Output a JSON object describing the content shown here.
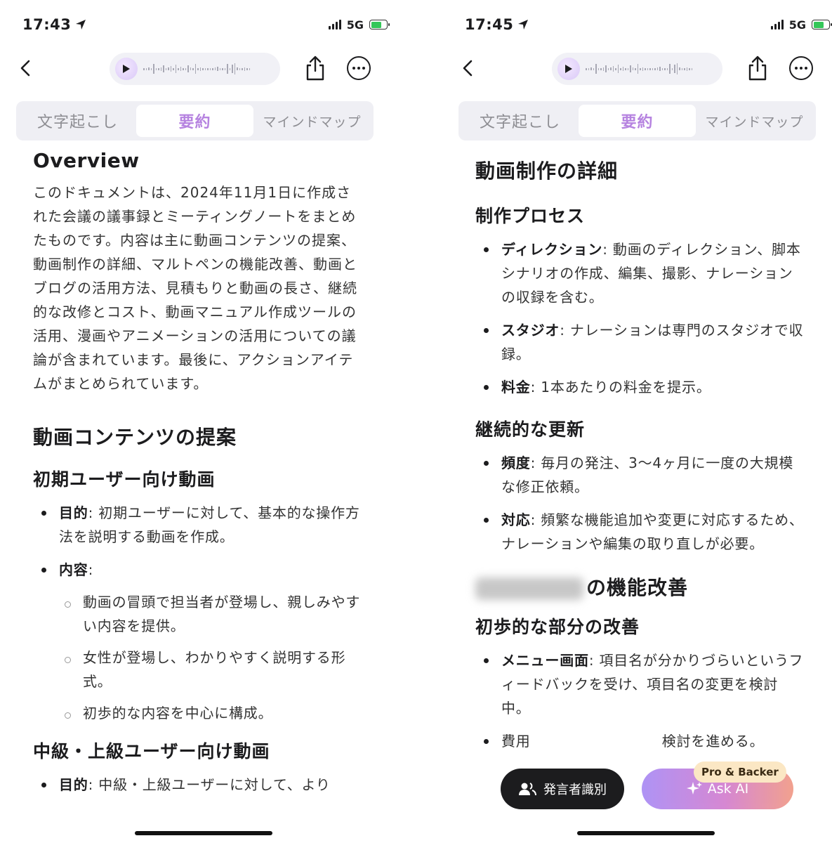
{
  "left": {
    "status": {
      "time": "17:43",
      "network": "5G"
    },
    "tabs": [
      "文字起こし",
      "要約",
      "マインドマップ"
    ],
    "overview_title": "Overview",
    "overview_text": "このドキュメントは、2024年11月1日に作成された会議の議事録とミーティングノートをまとめたものです。内容は主に動画コンテンツの提案、動画制作の詳細、マルトペンの機能改善、動画とブログの活用方法、見積もりと動画の長さ、継続的な改修とコスト、動画マニュアル作成ツールの活用、漫画やアニメーションの活用についての議論が含まれています。最後に、アクションアイテムがまとめられています。",
    "section1": {
      "title": "動画コンテンツの提案",
      "sub1": {
        "title": "初期ユーザー向け動画",
        "items": [
          {
            "label": "目的",
            "text": ": 初期ユーザーに対して、基本的な操作方法を説明する動画を作成。"
          },
          {
            "label": "内容",
            "text": ":"
          }
        ],
        "subitems": [
          "動画の冒頭で担当者が登場し、親しみやすい内容を提供。",
          "女性が登場し、わかりやすく説明する形式。",
          "初歩的な内容を中心に構成。"
        ]
      },
      "sub2": {
        "title": "中級・上級ユーザー向け動画",
        "items": [
          {
            "label": "目的",
            "text": ": 中級・上級ユーザーに対して、より"
          }
        ]
      }
    }
  },
  "right": {
    "status": {
      "time": "17:45",
      "network": "5G"
    },
    "tabs": [
      "文字起こし",
      "要約",
      "マインドマップ"
    ],
    "section_title": "動画制作の詳細",
    "process": {
      "title": "制作プロセス",
      "items": [
        {
          "label": "ディレクション",
          "text": ": 動画のディレクション、脚本シナリオの作成、編集、撮影、ナレーションの収録を含む。"
        },
        {
          "label": "スタジオ",
          "text": ": ナレーションは専門のスタジオで収録。"
        },
        {
          "label": "料金",
          "text": ": 1本あたりの料金を提示。"
        }
      ]
    },
    "update": {
      "title": "継続的な更新",
      "items": [
        {
          "label": "頻度",
          "text": ": 毎月の発注、3〜4ヶ月に一度の大規模な修正依頼。"
        },
        {
          "label": "対応",
          "text": ": 頻繁な機能追加や変更に対応するため、ナレーションや編集の取り直しが必要。"
        }
      ]
    },
    "improve_title_suffix": "の機能改善",
    "improve": {
      "title": "初歩的な部分の改善",
      "items": [
        {
          "label": "メニュー画面",
          "text": ": 項目名が分かりづらいというフィードバックを受け、項目名の変更を検討中。"
        },
        {
          "label": "",
          "text": "費用　　　　　　　　　検討を進める。"
        }
      ]
    },
    "speaker_button": "発言者識別",
    "askai_button": "Ask AI",
    "badge": "Pro & Backer"
  },
  "colors": {
    "accent": "#b683e0",
    "badge_bg": "#fbe7c4",
    "battery": "#34c759"
  },
  "icons": [
    "back-chevron-icon",
    "play-icon",
    "waveform-icon",
    "share-icon",
    "more-icon",
    "location-arrow-icon",
    "signal-icon",
    "battery-charging-icon",
    "people-icon",
    "sparkle-icon"
  ]
}
